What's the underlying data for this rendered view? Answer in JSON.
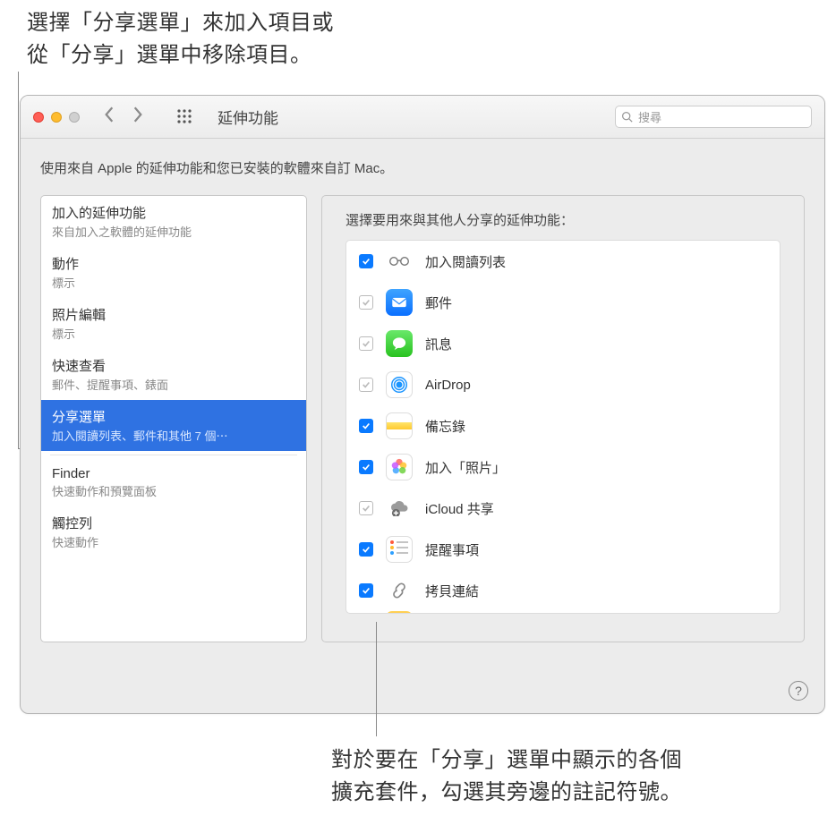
{
  "annotations": {
    "top_line1": "選擇「分享選單」來加入項目或",
    "top_line2": "從「分享」選單中移除項目。",
    "bottom_line1": "對於要在「分享」選單中顯示的各個",
    "bottom_line2": "擴充套件，勾選其旁邊的註記符號。"
  },
  "window": {
    "title": "延伸功能",
    "search_placeholder": "搜尋",
    "description": "使用來自 Apple 的延伸功能和您已安裝的軟體來自訂 Mac。",
    "help": "?"
  },
  "sidebar": {
    "items": [
      {
        "title": "加入的延伸功能",
        "sub": "來自加入之軟體的延伸功能"
      },
      {
        "title": "動作",
        "sub": "標示"
      },
      {
        "title": "照片編輯",
        "sub": "標示"
      },
      {
        "title": "快速查看",
        "sub": "郵件、提醒事項、錶面"
      },
      {
        "title": "分享選單",
        "sub": "加入閱讀列表、郵件和其他 7 個⋯"
      },
      {
        "title": "Finder",
        "sub": "快速動作和預覽面板"
      },
      {
        "title": "觸控列",
        "sub": "快速動作"
      }
    ]
  },
  "main": {
    "heading": "選擇要用來與其他人分享的延伸功能：",
    "rows": [
      {
        "label": "加入閱讀列表",
        "checked": true,
        "locked": false,
        "icon": "glasses"
      },
      {
        "label": "郵件",
        "checked": true,
        "locked": true,
        "icon": "mail"
      },
      {
        "label": "訊息",
        "checked": true,
        "locked": true,
        "icon": "messages"
      },
      {
        "label": "AirDrop",
        "checked": true,
        "locked": true,
        "icon": "airdrop"
      },
      {
        "label": "備忘錄",
        "checked": true,
        "locked": false,
        "icon": "notes"
      },
      {
        "label": "加入「照片」",
        "checked": true,
        "locked": false,
        "icon": "photos"
      },
      {
        "label": "iCloud 共享",
        "checked": true,
        "locked": true,
        "icon": "icloud"
      },
      {
        "label": "提醒事項",
        "checked": true,
        "locked": false,
        "icon": "reminders"
      },
      {
        "label": "拷貝連結",
        "checked": true,
        "locked": false,
        "icon": "link"
      }
    ]
  }
}
